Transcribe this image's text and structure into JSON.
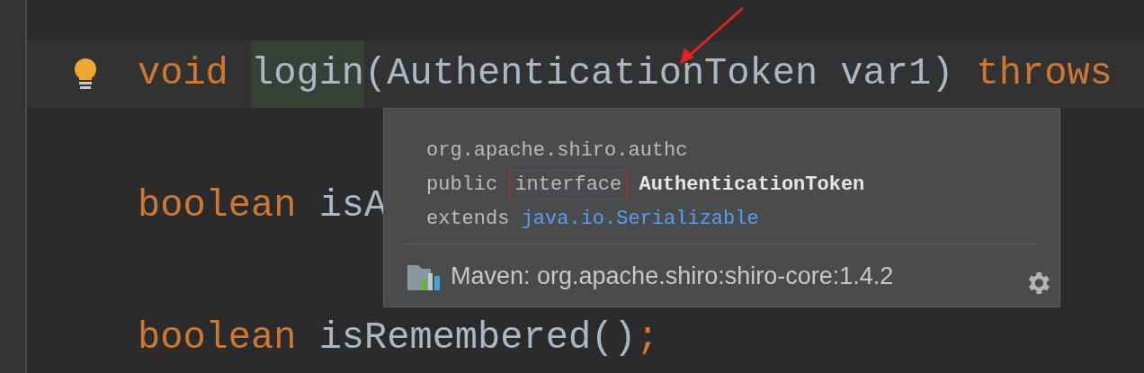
{
  "editor": {
    "lines": [
      {
        "current": true,
        "tokens": [
          {
            "kind": "keyword",
            "text": "void "
          },
          {
            "kind": "usage",
            "text": "login"
          },
          {
            "kind": "plain",
            "text": "(AuthenticationToken var1) "
          },
          {
            "kind": "keyword",
            "text": "throws"
          }
        ]
      },
      {
        "current": false,
        "tokens": [
          {
            "kind": "keyword",
            "text": "boolean"
          },
          {
            "kind": "plain",
            "text": " isA"
          }
        ]
      },
      {
        "current": false,
        "tokens": [
          {
            "kind": "keyword",
            "text": "boolean"
          },
          {
            "kind": "plain",
            "text": " isRemembered()"
          },
          {
            "kind": "keyword",
            "text": ";"
          }
        ]
      }
    ]
  },
  "quick_doc": {
    "package": "org.apache.shiro.authc",
    "signature": [
      {
        "kind": "plain",
        "text": "public "
      },
      {
        "kind": "boxed",
        "text": "interface"
      },
      {
        "kind": "name",
        "text": " AuthenticationToken"
      }
    ],
    "extends_label": "extends",
    "extends_link": "java.io.Serializable",
    "library": "Maven: org.apache.shiro:shiro-core:1.4.2"
  }
}
